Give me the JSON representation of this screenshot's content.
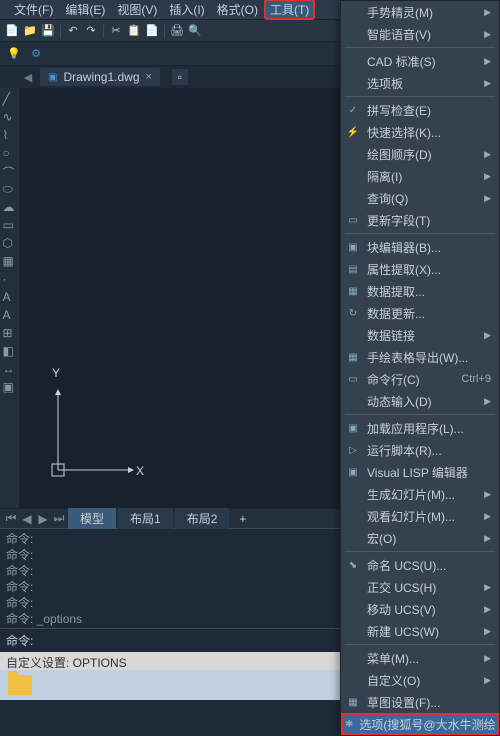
{
  "menubar": [
    "文件(F)",
    "编辑(E)",
    "视图(V)",
    "插入(I)",
    "格式(O)",
    "工具(T)"
  ],
  "menubar_hot_index": 5,
  "doc_tab": {
    "icon": "dwg-icon",
    "label": "Drawing1.dwg"
  },
  "layout_tabs": {
    "active": "模型",
    "items": [
      "模型",
      "布局1",
      "布局2"
    ]
  },
  "axis": {
    "x": "X",
    "y": "Y"
  },
  "cmd_history": [
    "命令:",
    "命令:",
    "命令:",
    "命令:",
    "命令:",
    "命令: _options"
  ],
  "cmd_prompt": "命令:",
  "statusbar": "自定义设置: OPTIONS",
  "dropdown": [
    {
      "label": "手势精灵(M)",
      "sub": true
    },
    {
      "label": "智能语音(V)",
      "sub": true
    },
    {
      "sep": true
    },
    {
      "label": "CAD 标准(S)",
      "sub": true
    },
    {
      "label": "选项板",
      "sub": true
    },
    {
      "sep": true
    },
    {
      "label": "拼写检查(E)",
      "icon": "✓"
    },
    {
      "label": "快速选择(K)...",
      "icon": "⚡"
    },
    {
      "label": "绘图顺序(D)",
      "sub": true
    },
    {
      "label": "隔离(I)",
      "sub": true
    },
    {
      "label": "查询(Q)",
      "sub": true
    },
    {
      "label": "更新字段(T)",
      "icon": "▭"
    },
    {
      "sep": true
    },
    {
      "label": "块编辑器(B)...",
      "icon": "▣"
    },
    {
      "label": "属性提取(X)...",
      "icon": "▤"
    },
    {
      "label": "数据提取...",
      "icon": "▦"
    },
    {
      "label": "数据更新...",
      "icon": "↻"
    },
    {
      "label": "数据链接",
      "sub": true
    },
    {
      "label": "手绘表格导出(W)...",
      "icon": "▦"
    },
    {
      "label": "命令行(C)",
      "icon": "▭",
      "shortcut": "Ctrl+9"
    },
    {
      "label": "动态输入(D)",
      "sub": true
    },
    {
      "sep": true
    },
    {
      "label": "加载应用程序(L)...",
      "icon": "▣"
    },
    {
      "label": "运行脚本(R)...",
      "icon": "▷"
    },
    {
      "label": "Visual LISP 编辑器",
      "icon": "▣"
    },
    {
      "label": "生成幻灯片(M)...",
      "sub": true
    },
    {
      "label": "观看幻灯片(M)...",
      "sub": true
    },
    {
      "label": "宏(O)",
      "sub": true
    },
    {
      "sep": true
    },
    {
      "label": "命名 UCS(U)...",
      "icon": "⬊"
    },
    {
      "label": "正交 UCS(H)",
      "sub": true
    },
    {
      "label": "移动 UCS(V)",
      "sub": true
    },
    {
      "label": "新建 UCS(W)",
      "sub": true
    },
    {
      "sep": true
    },
    {
      "label": "菜单(M)...",
      "sub": true
    },
    {
      "label": "自定义(O)",
      "sub": true
    },
    {
      "label": "草图设置(F)...",
      "icon": "▦"
    },
    {
      "label": "选项(搜狐号@大水牛测绘",
      "icon": "✱",
      "hot": true
    }
  ]
}
